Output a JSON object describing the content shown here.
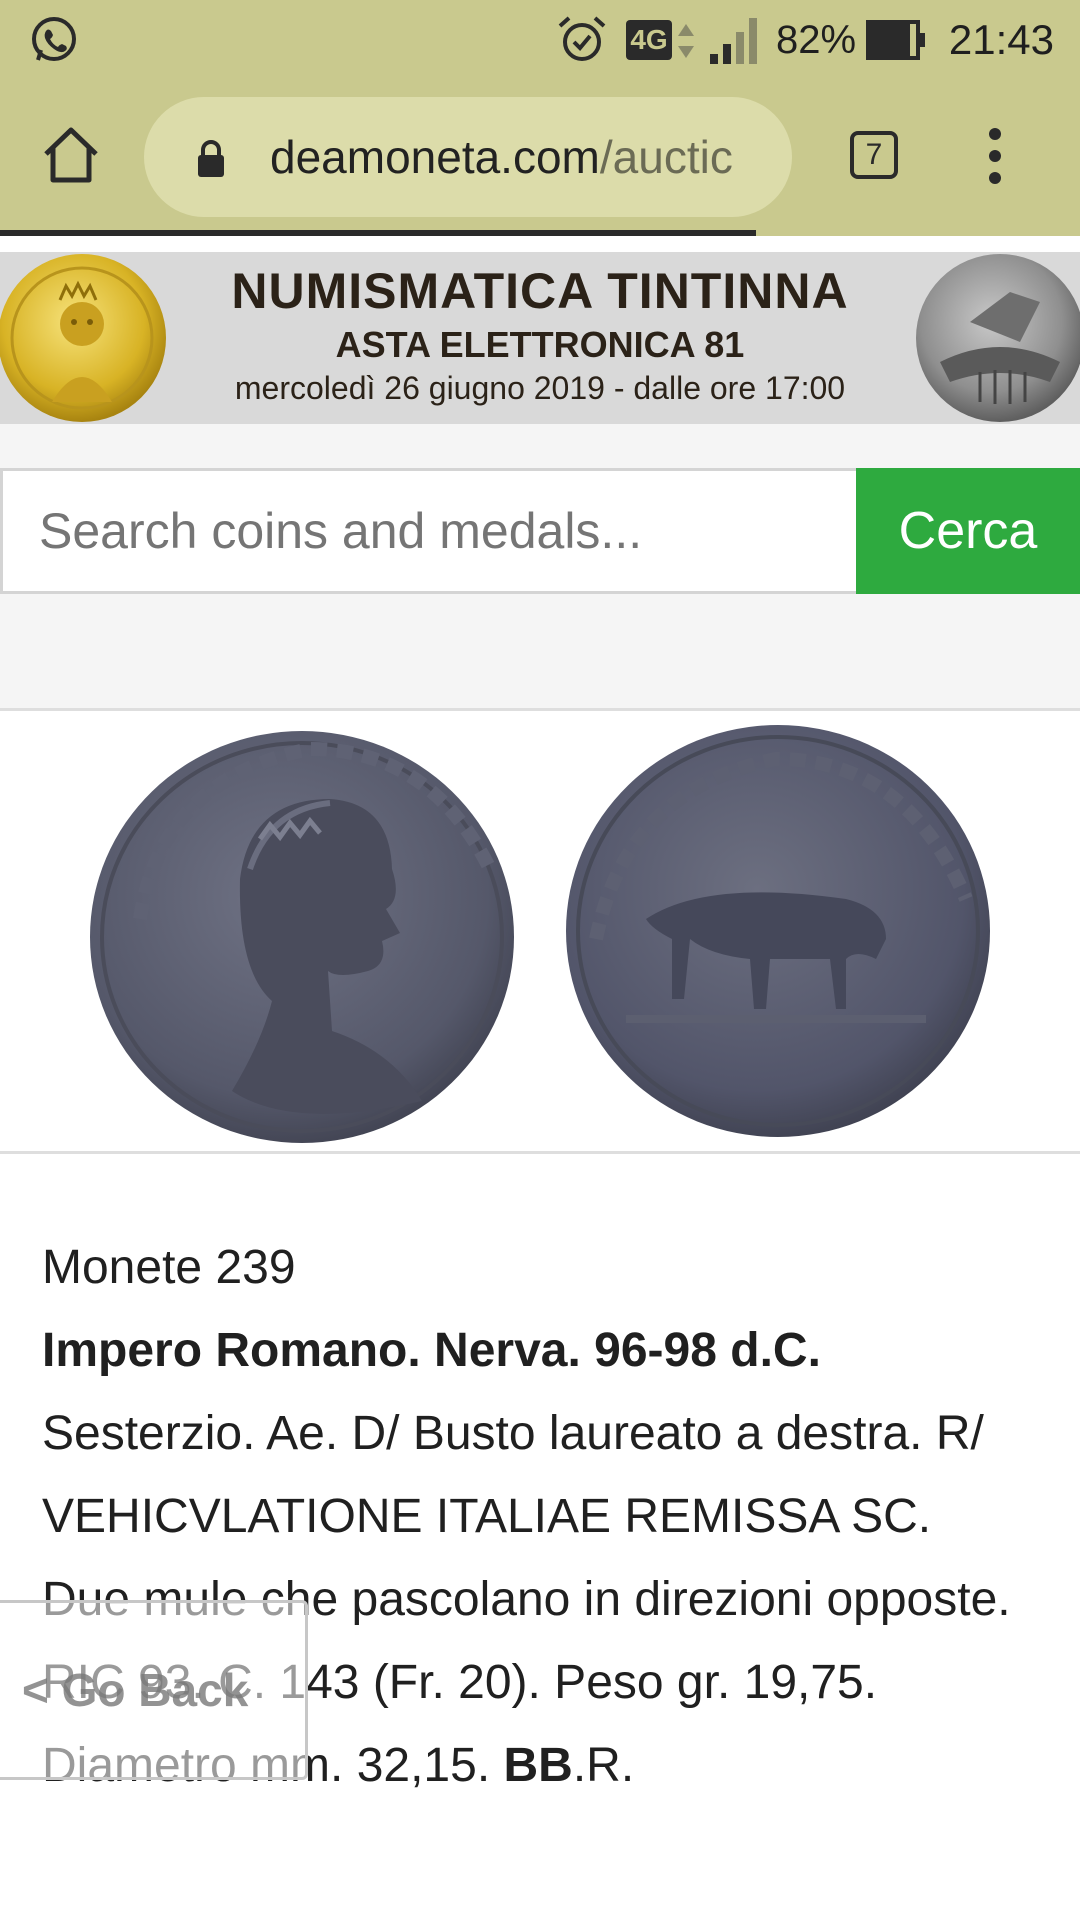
{
  "status_bar": {
    "icons": [
      "whatsapp-icon",
      "alarm-icon",
      "4g-icon",
      "signal-icon",
      "battery-icon"
    ],
    "network": "4G",
    "battery": "82%",
    "time": "21:43",
    "color": "#c9c98e"
  },
  "browser": {
    "url_domain": "deamoneta.com",
    "url_path": "/auctic",
    "tab_count": "7",
    "load_progress": 0.7
  },
  "banner": {
    "title": "NUMISMATICA TINTINNA",
    "subtitle": "ASTA ELETTRONICA 81",
    "date": "mercoledì 26 giugno 2019 - dalle ore 17:00"
  },
  "search": {
    "placeholder": "Search coins and medals...",
    "button_label": "Cerca",
    "button_color": "#2eaa3f"
  },
  "lot": {
    "number": "Monete 239",
    "heading": "Impero Romano. Nerva. 96-98 d.C.",
    "description": "Sesterzio. Ae. D/ Busto laureato a destra. R/ VEHICVLATIONE ITALIAE REMISSA SC. Due mule che pascolano in direzioni opposte. RIC 93. C. 143 (Fr. 20). Peso gr. 19,75. Diametro mm. 32,15.",
    "grade": "BB",
    "rarity": ".R."
  },
  "go_back": "< Go Back"
}
